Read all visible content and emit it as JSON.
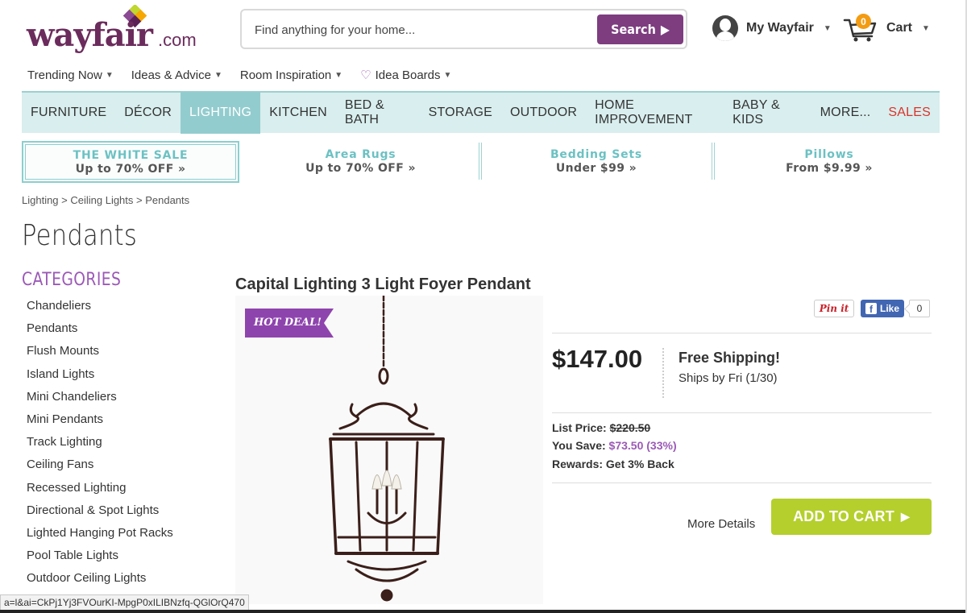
{
  "header": {
    "logo_text": "wayfair",
    "logo_suffix": ".com",
    "search": {
      "placeholder": "Find anything for your home...",
      "button_label": "Search"
    },
    "account_label": "My Wayfair",
    "cart_label": "Cart",
    "cart_count": "0"
  },
  "subnav": [
    {
      "label": "Trending Now"
    },
    {
      "label": "Ideas & Advice"
    },
    {
      "label": "Room Inspiration"
    },
    {
      "label": "Idea Boards"
    }
  ],
  "mainnav": [
    {
      "label": "FURNITURE"
    },
    {
      "label": "DÉCOR"
    },
    {
      "label": "LIGHTING"
    },
    {
      "label": "KITCHEN"
    },
    {
      "label": "BED & BATH"
    },
    {
      "label": "STORAGE"
    },
    {
      "label": "OUTDOOR"
    },
    {
      "label": "HOME IMPROVEMENT"
    },
    {
      "label": "BABY & KIDS"
    },
    {
      "label": "MORE..."
    },
    {
      "label": "SALES"
    }
  ],
  "promos": [
    {
      "title": "THE WHITE SALE",
      "sub": "Up to 70% OFF »"
    },
    {
      "title": "Area Rugs",
      "sub": "Up to 70% OFF »"
    },
    {
      "title": "Bedding Sets",
      "sub": "Under $99 »"
    },
    {
      "title": "Pillows",
      "sub": "From $9.99 »"
    }
  ],
  "breadcrumb": "Lighting > Ceiling Lights > Pendants",
  "page_title": "Pendants",
  "sidebar": {
    "title": "CATEGORIES",
    "items": [
      "Chandeliers",
      "Pendants",
      "Flush Mounts",
      "Island Lights",
      "Mini Chandeliers",
      "Mini Pendants",
      "Track Lighting",
      "Ceiling Fans",
      "Recessed Lighting",
      "Directional & Spot Lights",
      "Lighted Hanging Pot Racks",
      "Pool Table Lights",
      "Outdoor Ceiling Lights"
    ]
  },
  "product": {
    "title": "Capital Lighting 3 Light Foyer Pendant",
    "badge": "HOT DEAL!",
    "pin_label": "Pin it",
    "like_label": "Like",
    "like_count": "0",
    "price": "$147.00",
    "shipping_title": "Free Shipping!",
    "shipping_sub": "Ships by Fri (1/30)",
    "list_price_label": "List Price:",
    "list_price": "$220.50",
    "you_save_label": "You Save:",
    "you_save": "$73.50 (33%)",
    "rewards_label": "Rewards:",
    "rewards": "Get 3% Back",
    "more_details": "More Details",
    "add_to_cart": "ADD TO CART"
  },
  "status_url": "a=l&ai=CkPj1Yj3FVOurKI-MpgP0xILIBNzfq-QGlOrQ470",
  "colors": {
    "brand": "#6b2b5c",
    "accent": "#7d3d7f",
    "nav_bg": "#d9eeee",
    "nav_active": "#93ccce",
    "cta": "#b5cf2c",
    "sale": "#d9342b"
  }
}
